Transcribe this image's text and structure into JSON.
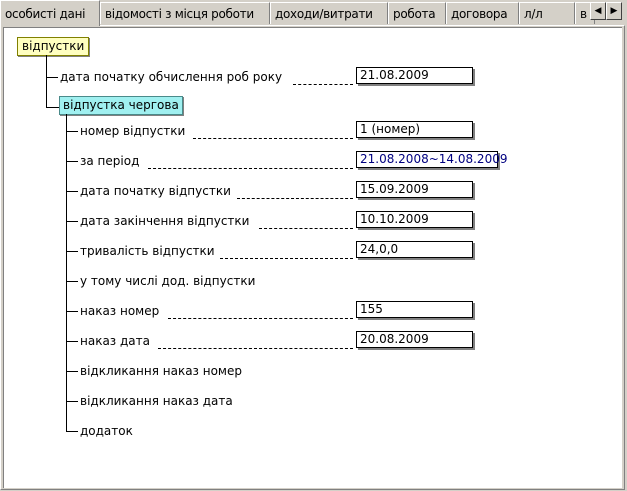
{
  "tabs": [
    {
      "label": "особисті дані"
    },
    {
      "label": "відомості з місця роботи"
    },
    {
      "label": "доходи/витрати"
    },
    {
      "label": "робота"
    },
    {
      "label": "договора"
    },
    {
      "label": "л/л"
    },
    {
      "label": "в"
    }
  ],
  "tree": {
    "root": "відпустки",
    "calc_start_label": "дата початку обчислення роб року",
    "calc_start_value": "21.08.2009",
    "sub": "відпустка чергова",
    "fields": [
      {
        "label": "номер відпустки",
        "value": "1   (номер)"
      },
      {
        "label": "за період",
        "value": "21.08.2008~14.08.2009"
      },
      {
        "label": "дата початку відпустки",
        "value": "15.09.2009"
      },
      {
        "label": "дата закінчення відпустки",
        "value": "10.10.2009"
      },
      {
        "label": "тривалість відпустки",
        "value": "24,0,0"
      },
      {
        "label": "у тому числі дод. відпустки",
        "value": ""
      },
      {
        "label": "наказ номер",
        "value": "155"
      },
      {
        "label": "наказ дата",
        "value": "20.08.2009"
      },
      {
        "label": "відкликання наказ номер",
        "value": ""
      },
      {
        "label": "відкликання наказ дата",
        "value": ""
      },
      {
        "label": "додаток",
        "value": ""
      }
    ]
  },
  "colors": {
    "root_bg": "#ffffc0",
    "sub_bg": "#a0f0f0",
    "period_text": "#000080"
  },
  "icons": {
    "scroll_left": "◀",
    "scroll_right": "▶"
  }
}
